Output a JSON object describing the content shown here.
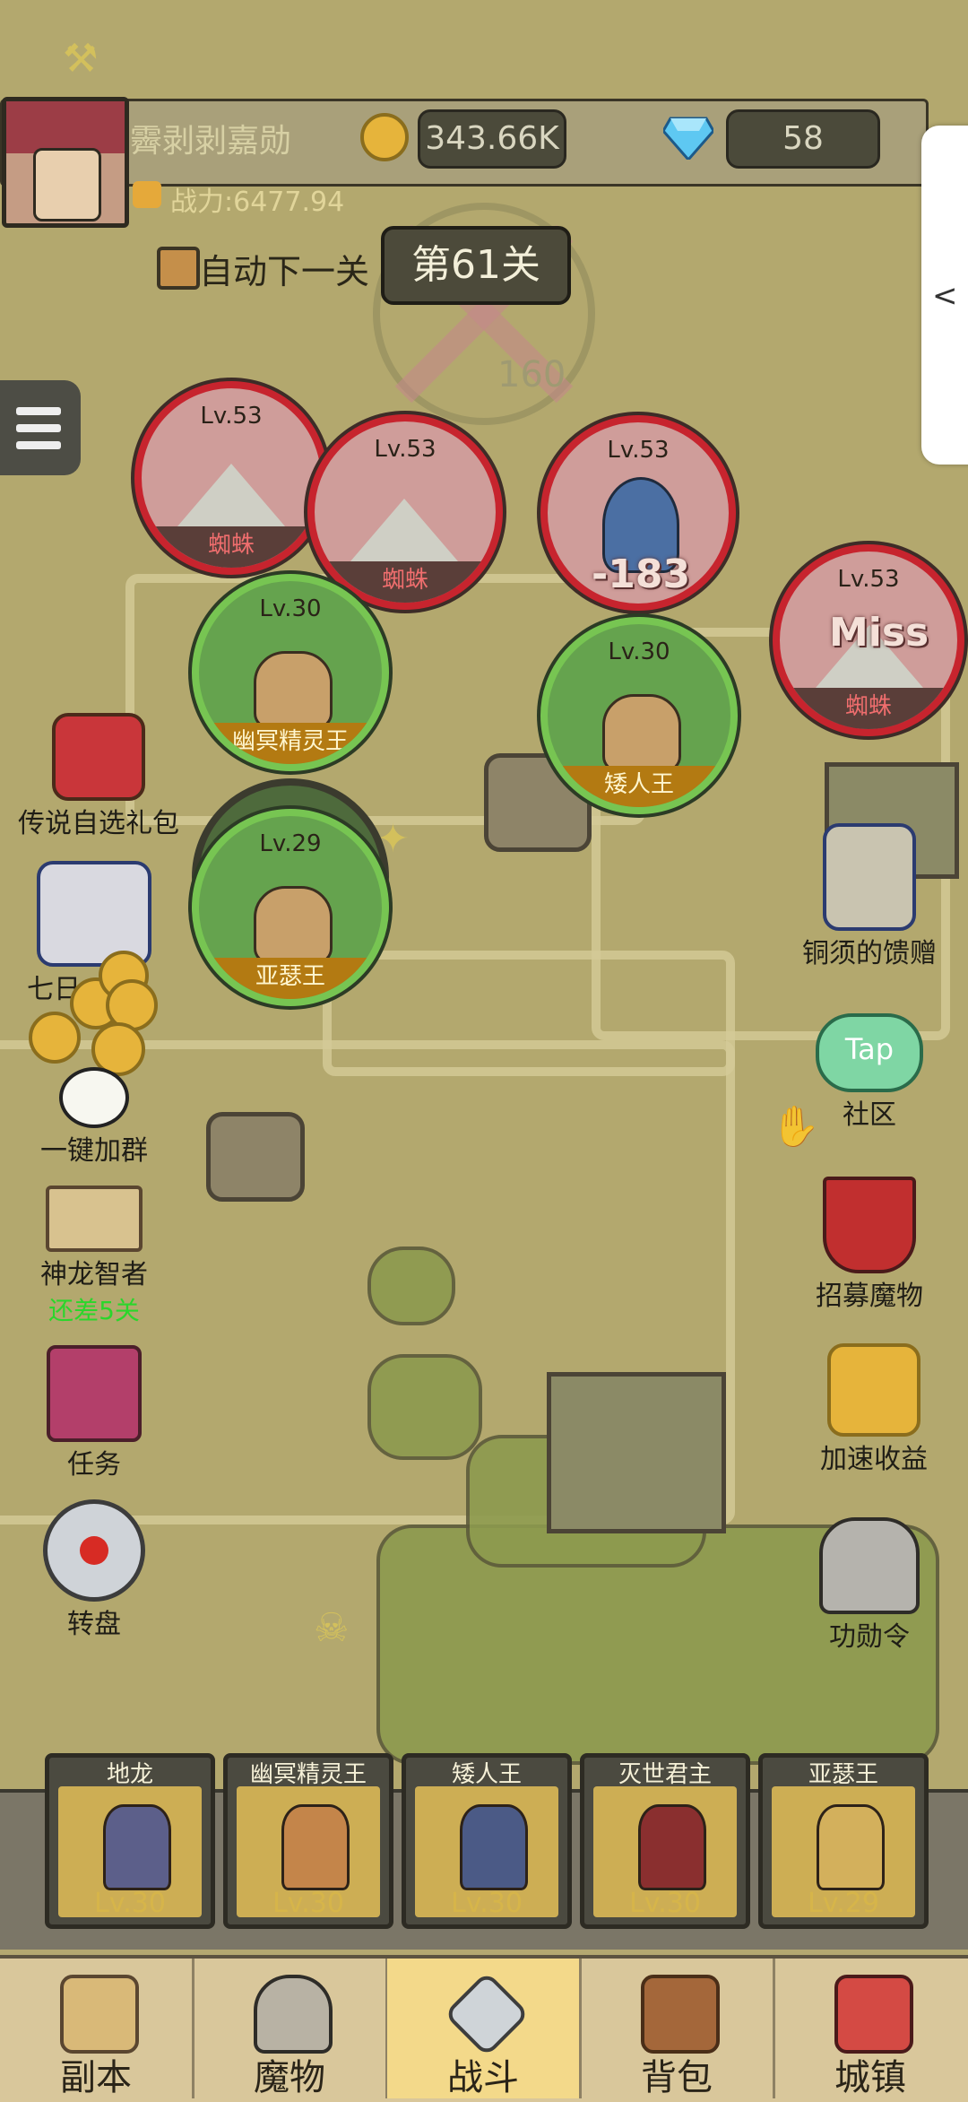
{
  "player": {
    "name": "霽剥剥嘉勋",
    "power": "战力:6477.94"
  },
  "currency": {
    "gold": "343.66K",
    "diamonds": "58"
  },
  "auto": {
    "label": "自动下一关"
  },
  "stage": {
    "label": "第61关"
  },
  "map_overlay": {
    "target_number": "160"
  },
  "enemies": [
    {
      "level": "Lv.53",
      "name": "蜘蛛"
    },
    {
      "level": "Lv.53",
      "name": "蜘蛛"
    },
    {
      "level": "Lv.53",
      "name": "",
      "damage": "-183"
    },
    {
      "level": "Lv.53",
      "name": "蜘蛛",
      "status": "Miss"
    }
  ],
  "allies": [
    {
      "level": "Lv.30",
      "name": "幽冥精灵王"
    },
    {
      "level": "Lv.30",
      "name": "矮人王"
    },
    {
      "level": "Lv.29",
      "name": "亚瑟王"
    }
  ],
  "left_icons": [
    {
      "label": "传说自选礼包"
    },
    {
      "label": "七日"
    },
    {
      "label": "一键加群"
    },
    {
      "label": "神龙智者",
      "sub": "还差5关"
    },
    {
      "label": "任务"
    },
    {
      "label": "转盘"
    }
  ],
  "right_icons": [
    {
      "label": "铜须的馈赠"
    },
    {
      "label": "社区",
      "badge": "Tap"
    },
    {
      "label": "招募魔物"
    },
    {
      "label": "加速收益"
    },
    {
      "label": "功勋令"
    }
  ],
  "hero_slots": [
    {
      "name": "地龙",
      "level": "Lv.30"
    },
    {
      "name": "幽冥精灵王",
      "level": "Lv.30"
    },
    {
      "name": "矮人王",
      "level": "Lv.30"
    },
    {
      "name": "灭世君主",
      "level": "Lv.30"
    },
    {
      "name": "亚瑟王",
      "level": "Lv.29"
    }
  ],
  "nav": {
    "tabs": [
      "副本",
      "魔物",
      "战斗",
      "背包",
      "城镇"
    ],
    "active": "战斗"
  },
  "icons": {
    "collapse": "chevron-left-icon",
    "menu": "hamburger-icon"
  },
  "colors": {
    "enemy_ring": "#c7242e",
    "ally_ring": "#77c552",
    "active_tab": "#f3d98a"
  }
}
